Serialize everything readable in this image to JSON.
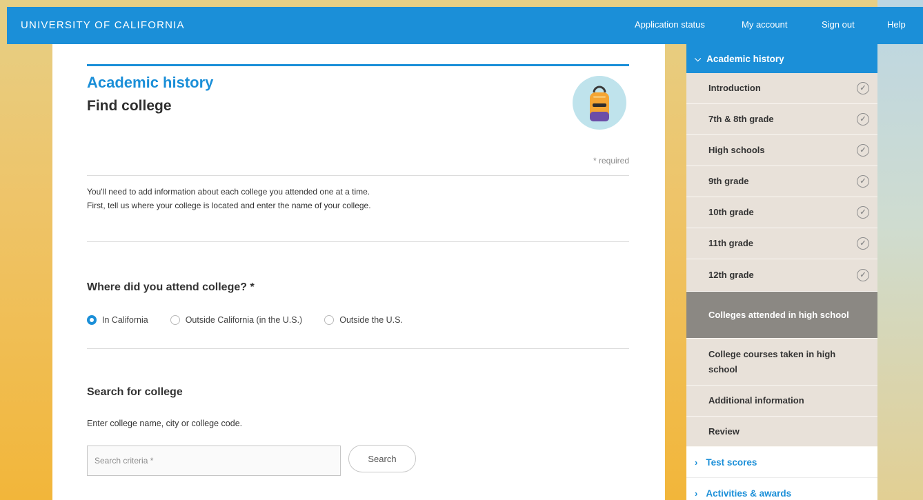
{
  "header": {
    "brand": "UNIVERSITY OF CALIFORNIA",
    "nav": [
      "Application status",
      "My account",
      "Sign out",
      "Help"
    ]
  },
  "main": {
    "section_title": "Academic history",
    "page_title": "Find college",
    "icon": "backpack-icon",
    "required_note": "* required",
    "intro_line1": "You'll need to add information about each college you attended one at a time.",
    "intro_line2": "First, tell us where your college is located and enter the name of your college.",
    "question": "Where did you attend college? *",
    "radio_options": [
      "In California",
      "Outside California (in the U.S.)",
      "Outside the U.S."
    ],
    "radio_selected": "In California",
    "search_heading": "Search for college",
    "search_help": "Enter college name, city or college code.",
    "search_placeholder": "Search criteria *",
    "search_value": "",
    "search_button": "Search"
  },
  "sidebar": {
    "section": "Academic history",
    "items": [
      {
        "label": "Introduction",
        "complete": true
      },
      {
        "label": "7th & 8th grade",
        "complete": true
      },
      {
        "label": "High schools",
        "complete": true
      },
      {
        "label": "9th grade",
        "complete": true
      },
      {
        "label": "10th grade",
        "complete": true
      },
      {
        "label": "11th grade",
        "complete": true
      },
      {
        "label": "12th grade",
        "complete": true
      },
      {
        "label": "Colleges attended in high school",
        "active": true
      },
      {
        "label": "College courses taken in high school"
      },
      {
        "label": "Additional information"
      },
      {
        "label": "Review"
      }
    ],
    "links": [
      "Test scores",
      "Activities & awards"
    ]
  },
  "colors": {
    "accent": "#1b8fd8",
    "active_item": "#8b8883",
    "item_bg": "#e8e1d9"
  }
}
